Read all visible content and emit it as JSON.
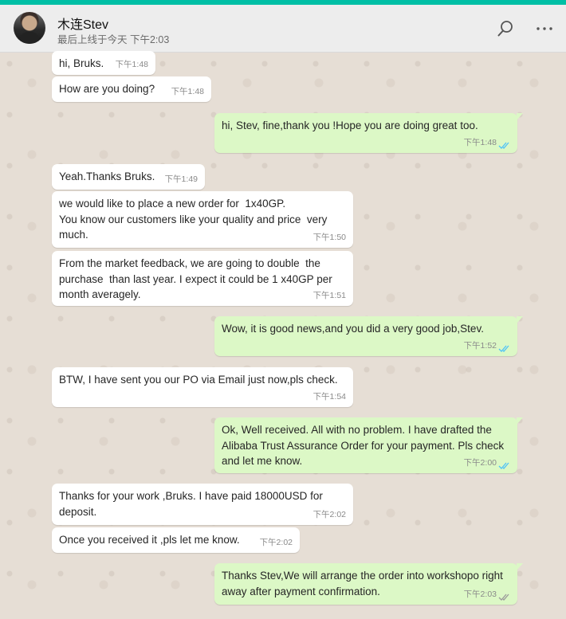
{
  "header": {
    "contact_name": "木连Stev",
    "last_seen": "最后上线于今天 下午2:03"
  },
  "colors": {
    "accent": "#00bfa5",
    "incoming_bubble": "#ffffff",
    "outgoing_bubble": "#dcf8c6",
    "read_ticks": "#4fc3f7"
  },
  "icons": [
    "search-icon",
    "more-options-icon",
    "double-check-icon"
  ],
  "messages": [
    {
      "direction": "in",
      "text": "hi, Bruks.",
      "time": "下午1:48"
    },
    {
      "direction": "in",
      "text": "How are you doing?",
      "time": "下午1:48"
    },
    {
      "direction": "out",
      "text": "hi, Stev, fine,thank you !Hope you are doing great too.",
      "time": "下午1:48",
      "status": "read"
    },
    {
      "direction": "in",
      "text": "Yeah.Thanks Bruks.",
      "time": "下午1:49"
    },
    {
      "direction": "in",
      "text": "we would like to place a new order for  1x40GP.\nYou know our customers like your quality and price  very much.",
      "time": "下午1:50"
    },
    {
      "direction": "in",
      "text": "From the market feedback, we are going to double  the purchase  than last year. I expect it could be 1 x40GP per month averagely.",
      "time": "下午1:51"
    },
    {
      "direction": "out",
      "text": "Wow, it is good news,and you did a very good job,Stev.",
      "time": "下午1:52",
      "status": "read"
    },
    {
      "direction": "in",
      "text": "BTW, I have sent you our PO via Email just now,pls check.",
      "time": "下午1:54"
    },
    {
      "direction": "out",
      "text": "Ok, Well received. All with no problem. I have drafted the Alibaba Trust Assurance Order for your payment. Pls check and let me know.",
      "time": "下午2:00",
      "status": "read"
    },
    {
      "direction": "in",
      "text": "Thanks for your work ,Bruks. I have paid 18000USD for deposit.",
      "time": "下午2:02"
    },
    {
      "direction": "in",
      "text": "Once you received it ,pls let me know.",
      "time": "下午2:02"
    },
    {
      "direction": "out",
      "text": "Thanks Stev,We will arrange the order into workshopo right away after payment confirmation.",
      "time": "下午2:03",
      "status": "delivered"
    }
  ]
}
